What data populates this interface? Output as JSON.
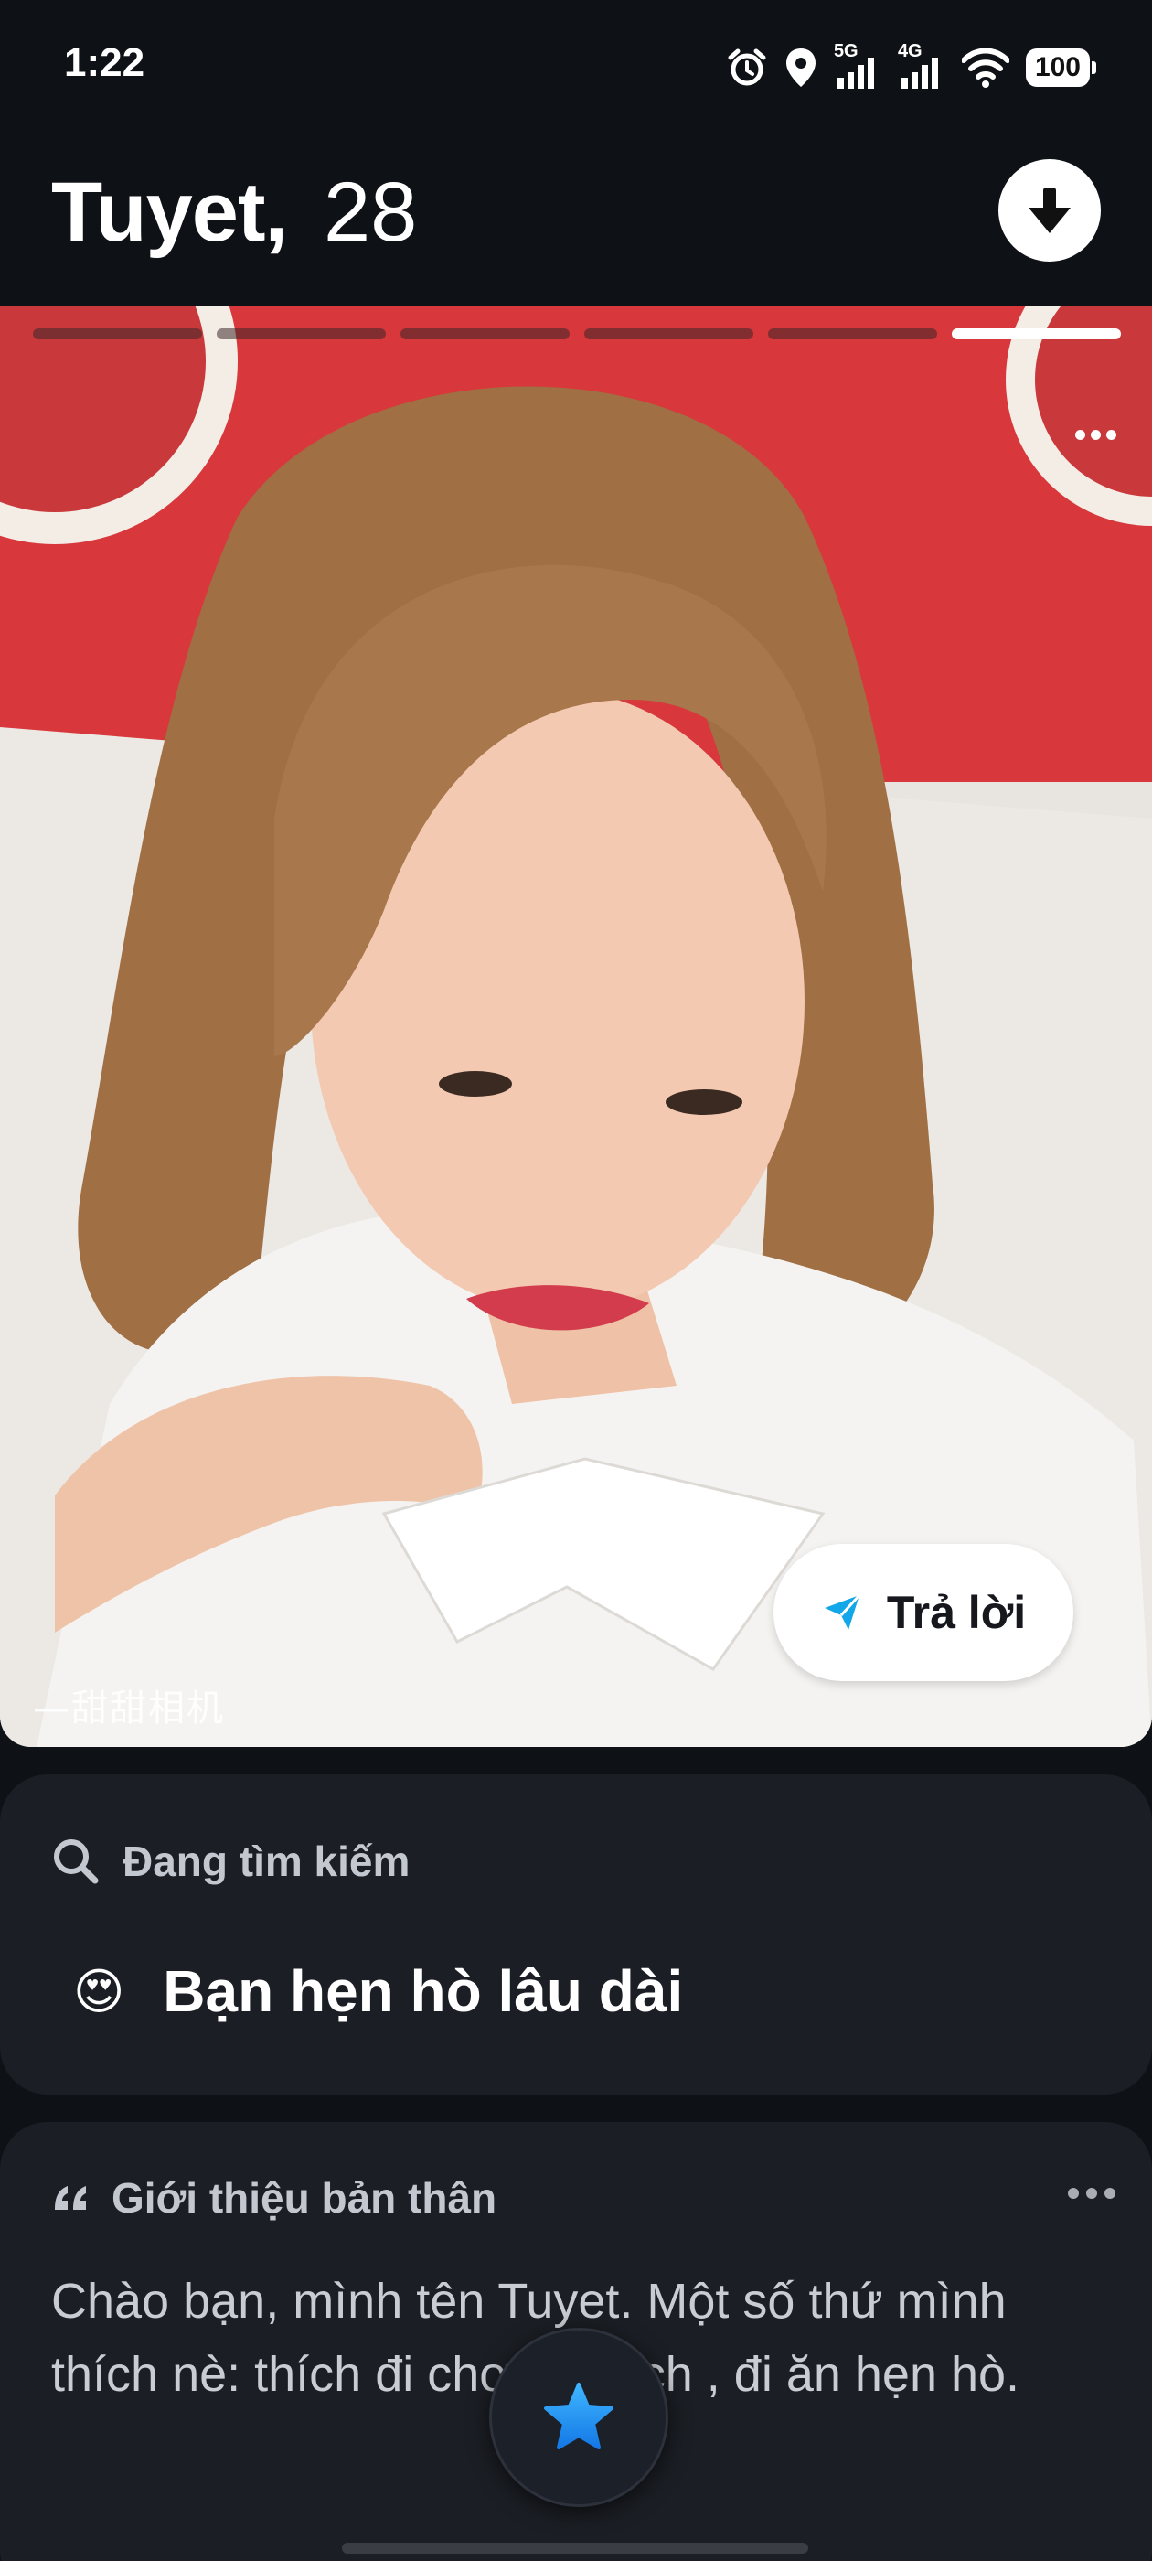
{
  "status_bar": {
    "time": "1:22",
    "net1": "5G",
    "net2": "4G",
    "battery": "100",
    "icons": [
      "alarm-icon",
      "location-icon",
      "signal-5g-icon",
      "signal-4g-icon",
      "wifi-icon",
      "battery-icon"
    ]
  },
  "profile": {
    "name": "Tuyet,",
    "age": "28"
  },
  "photo": {
    "total_photos": 6,
    "active_photo": 6,
    "watermark": "—甜甜相机",
    "reply_label": "Trả lời"
  },
  "looking_for": {
    "heading": "Đang tìm kiếm",
    "emoji": "😍",
    "value": "Bạn hẹn hò lâu dài"
  },
  "about": {
    "heading": "Giới thiệu bản thân",
    "text": "Chào bạn, mình tên Tuyet. Một số thứ mình thích nè: thích đi chơi, du lịch , đi ăn hẹn hò."
  },
  "colors": {
    "background": "#0e1116",
    "card": "#1b1e24",
    "accent_blue": "#1a8cff",
    "reply_icon": "#12a7e8"
  }
}
